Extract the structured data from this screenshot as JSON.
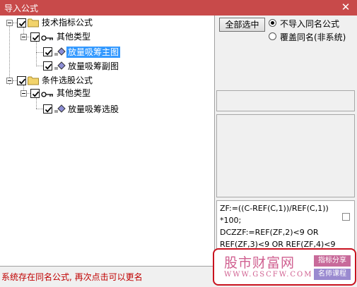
{
  "window": {
    "title": "导入公式",
    "close_glyph": "✕"
  },
  "tree": {
    "groups": [
      {
        "label": "技术指标公式",
        "checked": true,
        "children": [
          {
            "label": "其他类型",
            "checked": true,
            "items": [
              {
                "label": "放量吸筹主图",
                "checked": true,
                "selected": true
              },
              {
                "label": "放量吸筹副图",
                "checked": true,
                "selected": false
              }
            ]
          }
        ]
      },
      {
        "label": "条件选股公式",
        "checked": true,
        "children": [
          {
            "label": "其他类型",
            "checked": true,
            "items": [
              {
                "label": "放量吸筹选股",
                "checked": true,
                "selected": false
              }
            ]
          }
        ]
      }
    ]
  },
  "controls": {
    "select_all_label": "全部选中",
    "options": [
      {
        "label": "不导入同名公式",
        "selected": true
      },
      {
        "label": "覆盖同名(非系统)",
        "selected": false
      }
    ]
  },
  "formula_preview": {
    "lines": [
      "ZF:=((C-REF(C,1))/REF(C,1))",
      "*100;",
      "DCZZF:=REF(ZF,2)<9 OR",
      "REF(ZF,3)<9 OR REF(ZF,4)<9"
    ]
  },
  "status": {
    "message": "系统存在同名公式, 再次点击可以更名"
  },
  "watermark": {
    "brand": "股市财富网",
    "url": "WWW.GSCFW.COM",
    "tags": [
      "指标分享",
      "名师课程"
    ]
  },
  "colors": {
    "titlebar": "#c84a4a",
    "selection": "#3399ff",
    "status_text": "#c00000",
    "watermark_border": "#c9121f",
    "watermark_text": "#d06090",
    "tag_one": "#c86a9a",
    "tag_two": "#9a8ad0"
  }
}
